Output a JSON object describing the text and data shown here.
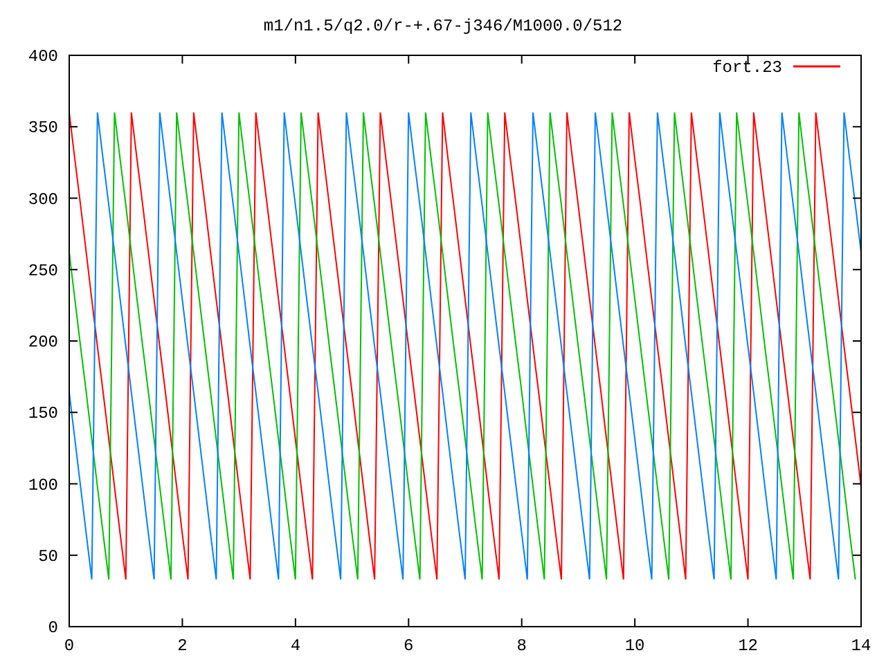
{
  "chart_data": {
    "type": "line",
    "title": "m1/n1.5/q2.0/r-+.67-j346/M1000.0/512",
    "xlim": [
      0,
      14
    ],
    "ylim": [
      0,
      400
    ],
    "xticks": [
      0,
      2,
      4,
      6,
      8,
      10,
      12,
      14
    ],
    "yticks": [
      0,
      50,
      100,
      150,
      200,
      250,
      300,
      350,
      400
    ],
    "x": [
      0,
      0.1,
      0.2,
      0.3,
      0.4,
      0.5,
      0.6,
      0.7,
      0.8,
      0.9,
      1,
      1.1,
      1.2,
      1.3,
      1.4,
      1.5,
      1.6,
      1.7,
      1.8,
      1.9,
      2,
      2.1,
      2.2,
      2.3,
      2.4,
      2.5,
      2.6,
      2.7,
      2.8,
      2.9,
      3,
      3.1,
      3.2,
      3.3,
      3.4,
      3.5,
      3.6,
      3.7,
      3.8,
      3.9,
      4,
      4.1,
      4.2,
      4.3,
      4.4,
      4.5,
      4.6,
      4.7,
      4.8,
      4.9,
      5,
      5.1,
      5.2,
      5.3,
      5.4,
      5.5,
      5.6,
      5.7,
      5.8,
      5.9,
      6,
      6.1,
      6.2,
      6.3,
      6.4,
      6.5,
      6.6,
      6.7,
      6.8,
      6.9,
      7,
      7.1,
      7.2,
      7.3,
      7.4,
      7.5,
      7.6,
      7.7,
      7.8,
      7.9,
      8,
      8.1,
      8.2,
      8.3,
      8.4,
      8.5,
      8.6,
      8.7,
      8.8,
      8.9,
      9,
      9.1,
      9.2,
      9.3,
      9.4,
      9.5,
      9.6,
      9.7,
      9.8,
      9.9,
      10,
      10.1,
      10.2,
      10.3,
      10.4,
      10.5,
      10.6,
      10.7,
      10.8,
      10.9,
      11,
      11.1,
      11.2,
      11.3,
      11.4,
      11.5,
      11.6,
      11.7,
      11.8,
      11.9,
      12,
      12.1,
      12.2,
      12.3,
      12.4,
      12.5,
      12.6,
      12.7,
      12.8,
      12.9,
      13,
      13.1,
      13.2,
      13.3,
      13.4,
      13.5,
      13.6,
      13.7,
      13.8,
      13.9,
      14
    ],
    "series": [
      {
        "name": "fort.23",
        "color": "#ff0000",
        "values": [
          360,
          327,
          295,
          262,
          229,
          196,
          164,
          131,
          98,
          65,
          33,
          360,
          327,
          295,
          262,
          229,
          196,
          164,
          131,
          98,
          65,
          33,
          360,
          327,
          295,
          262,
          229,
          196,
          164,
          131,
          98,
          65,
          33,
          360,
          327,
          295,
          262,
          229,
          196,
          164,
          131,
          98,
          65,
          33,
          360,
          327,
          295,
          262,
          229,
          196,
          164,
          131,
          98,
          65,
          33,
          360,
          327,
          295,
          262,
          229,
          196,
          164,
          131,
          98,
          65,
          33,
          360,
          327,
          295,
          262,
          229,
          196,
          164,
          131,
          98,
          65,
          33,
          360,
          327,
          295,
          262,
          229,
          196,
          164,
          131,
          98,
          65,
          33,
          360,
          327,
          295,
          262,
          229,
          196,
          164,
          131,
          98,
          65,
          33,
          360,
          327,
          295,
          262,
          229,
          196,
          164,
          131,
          98,
          65,
          33,
          360,
          327,
          295,
          262,
          229,
          196,
          164,
          131,
          98,
          65,
          33,
          360,
          327,
          295,
          262,
          229,
          196,
          164,
          131,
          98,
          65,
          33,
          360,
          327,
          295,
          262,
          229,
          196,
          164,
          131,
          98
        ]
      },
      {
        "color": "#00c000",
        "values": [
          262,
          229,
          196,
          164,
          131,
          98,
          65,
          33,
          360,
          327,
          295,
          262,
          229,
          196,
          164,
          131,
          98,
          65,
          33,
          360,
          327,
          295,
          262,
          229,
          196,
          164,
          131,
          98,
          65,
          33,
          360,
          327,
          295,
          262,
          229,
          196,
          164,
          131,
          98,
          65,
          33,
          360,
          327,
          295,
          262,
          229,
          196,
          164,
          131,
          98,
          65,
          33,
          360,
          327,
          295,
          262,
          229,
          196,
          164,
          131,
          98,
          65,
          33,
          360,
          327,
          295,
          262,
          229,
          196,
          164,
          131,
          98,
          65,
          33,
          360,
          327,
          295,
          262,
          229,
          196,
          164,
          131,
          98,
          65,
          33,
          360,
          327,
          295,
          262,
          229,
          196,
          164,
          131,
          98,
          65,
          33,
          360,
          327,
          295,
          262,
          229,
          196,
          164,
          131,
          98,
          65,
          33,
          360,
          327,
          295,
          262,
          229,
          196,
          164,
          131,
          98,
          65,
          33,
          360,
          327,
          295,
          262,
          229,
          196,
          164,
          131,
          98,
          65,
          33,
          360,
          327,
          295,
          262,
          229,
          196,
          164,
          131,
          98,
          65,
          33,
          null
        ]
      },
      {
        "color": "#0080ff",
        "values": [
          164,
          131,
          98,
          65,
          33,
          360,
          327,
          295,
          262,
          229,
          196,
          164,
          131,
          98,
          65,
          33,
          360,
          327,
          295,
          262,
          229,
          196,
          164,
          131,
          98,
          65,
          33,
          360,
          327,
          295,
          262,
          229,
          196,
          164,
          131,
          98,
          65,
          33,
          360,
          327,
          295,
          262,
          229,
          196,
          164,
          131,
          98,
          65,
          33,
          360,
          327,
          295,
          262,
          229,
          196,
          164,
          131,
          98,
          65,
          33,
          360,
          327,
          295,
          262,
          229,
          196,
          164,
          131,
          98,
          65,
          33,
          360,
          327,
          295,
          262,
          229,
          196,
          164,
          131,
          98,
          65,
          33,
          360,
          327,
          295,
          262,
          229,
          196,
          164,
          131,
          98,
          65,
          33,
          360,
          327,
          295,
          262,
          229,
          196,
          164,
          131,
          98,
          65,
          33,
          360,
          327,
          295,
          262,
          229,
          196,
          164,
          131,
          98,
          65,
          33,
          360,
          327,
          295,
          262,
          229,
          196,
          164,
          131,
          98,
          65,
          33,
          360,
          327,
          295,
          262,
          229,
          196,
          164,
          131,
          98,
          65,
          33,
          360,
          327,
          295,
          262
        ]
      }
    ]
  }
}
